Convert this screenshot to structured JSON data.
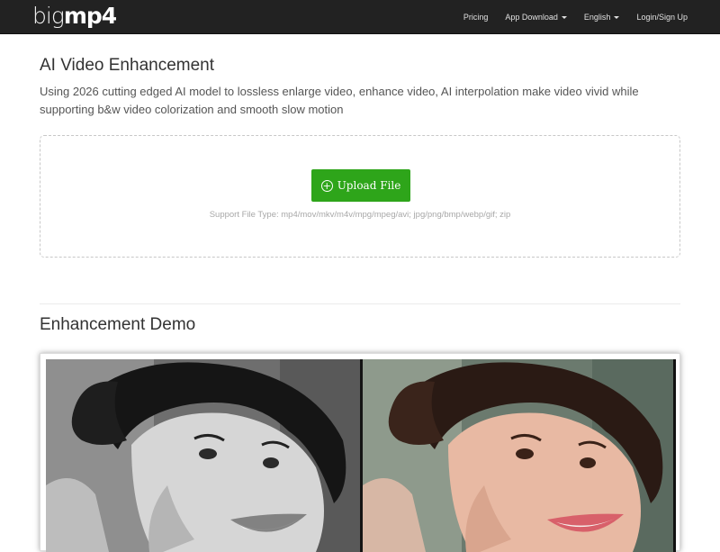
{
  "brand": {
    "light": "big",
    "bold": "mp4"
  },
  "nav": [
    {
      "label": "Pricing",
      "dropdown": false
    },
    {
      "label": "App Download",
      "dropdown": true
    },
    {
      "label": "English",
      "dropdown": true
    },
    {
      "label": "Login/Sign Up",
      "dropdown": false
    }
  ],
  "hero": {
    "title": "AI Video Enhancement",
    "description": "Using 2026 cutting edged AI model to lossless enlarge video, enhance video, AI interpolation make video vivid while supporting b&w video colorization and smooth slow motion"
  },
  "upload": {
    "button_label": "Upload File",
    "support_text": "Support File Type: mp4/mov/mkv/m4v/mpg/mpeg/avi; jpg/png/bmp/webp/gif; zip"
  },
  "demo": {
    "title": "Enhancement Demo"
  },
  "colors": {
    "navbar": "#222222",
    "upload_button": "#2ea51a"
  },
  "icons": {
    "upload": "plus-circle-icon",
    "dropdown": "caret-down-icon"
  }
}
